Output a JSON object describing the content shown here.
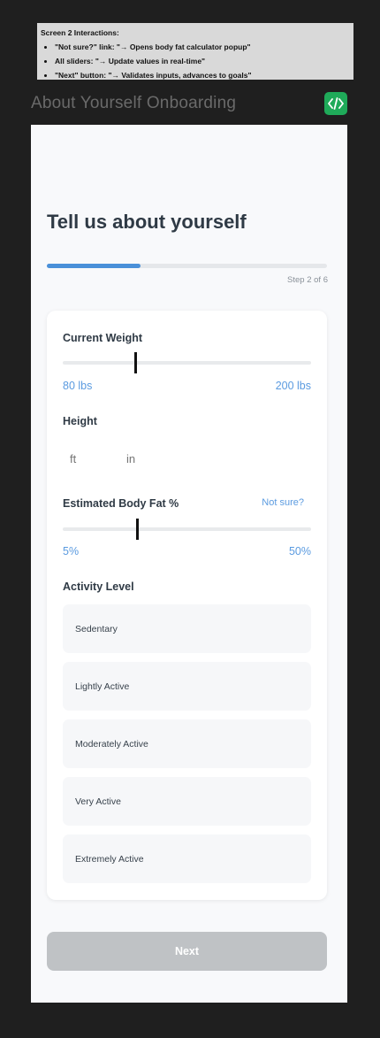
{
  "annotation": {
    "title": "Screen 2 Interactions:",
    "items": [
      "\"Not sure?\" link: \"→ Opens body fat calculator popup\"",
      "All sliders: \"→ Update values in real-time\"",
      "\"Next\" button: \"→ Validates inputs, advances to goals\""
    ]
  },
  "frame": {
    "title": "About Yourself Onboarding",
    "badge_icon": "code-icon",
    "badge_color": "#1faa59"
  },
  "screen": {
    "heading": "Tell us about yourself",
    "progress": {
      "step_label": "Step 2 of 6",
      "fraction": 0.333,
      "color": "#4a90d9"
    },
    "weight": {
      "label": "Current Weight",
      "min_label": "80 lbs",
      "max_label": "200 lbs",
      "min": 80,
      "max": 200,
      "value": 115
    },
    "height": {
      "label": "Height",
      "ft_placeholder": "ft",
      "in_placeholder": "in"
    },
    "body_fat": {
      "label": "Estimated Body Fat %",
      "link_label": "Not sure?",
      "min_label": "5%",
      "max_label": "50%",
      "min": 5,
      "max": 50,
      "value": 18.5
    },
    "activity": {
      "label": "Activity Level",
      "options": [
        "Sedentary",
        "Lightly Active",
        "Moderately Active",
        "Very Active",
        "Extremely Active"
      ]
    },
    "next_label": "Next"
  }
}
